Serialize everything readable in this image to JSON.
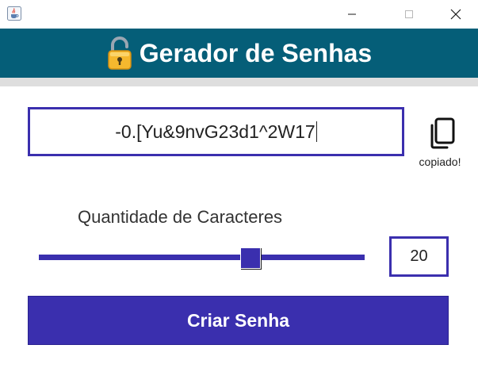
{
  "window": {
    "app_icon": "java-cup-icon",
    "controls": [
      "minimize-icon",
      "maximize-icon",
      "close-icon"
    ]
  },
  "header": {
    "icon": "lock-icon",
    "title": "Gerador de Senhas",
    "background": "#055e78"
  },
  "password": {
    "value": "-0.[Yu&9nvG23d1^2W17"
  },
  "copy": {
    "icon": "copy-icon",
    "status": "copiado!"
  },
  "length": {
    "label": "Quantidade de Caracteres",
    "value": "20",
    "slider_fraction": 0.66
  },
  "actions": {
    "create_label": "Criar Senha"
  },
  "colors": {
    "accent": "#3a2fae"
  }
}
